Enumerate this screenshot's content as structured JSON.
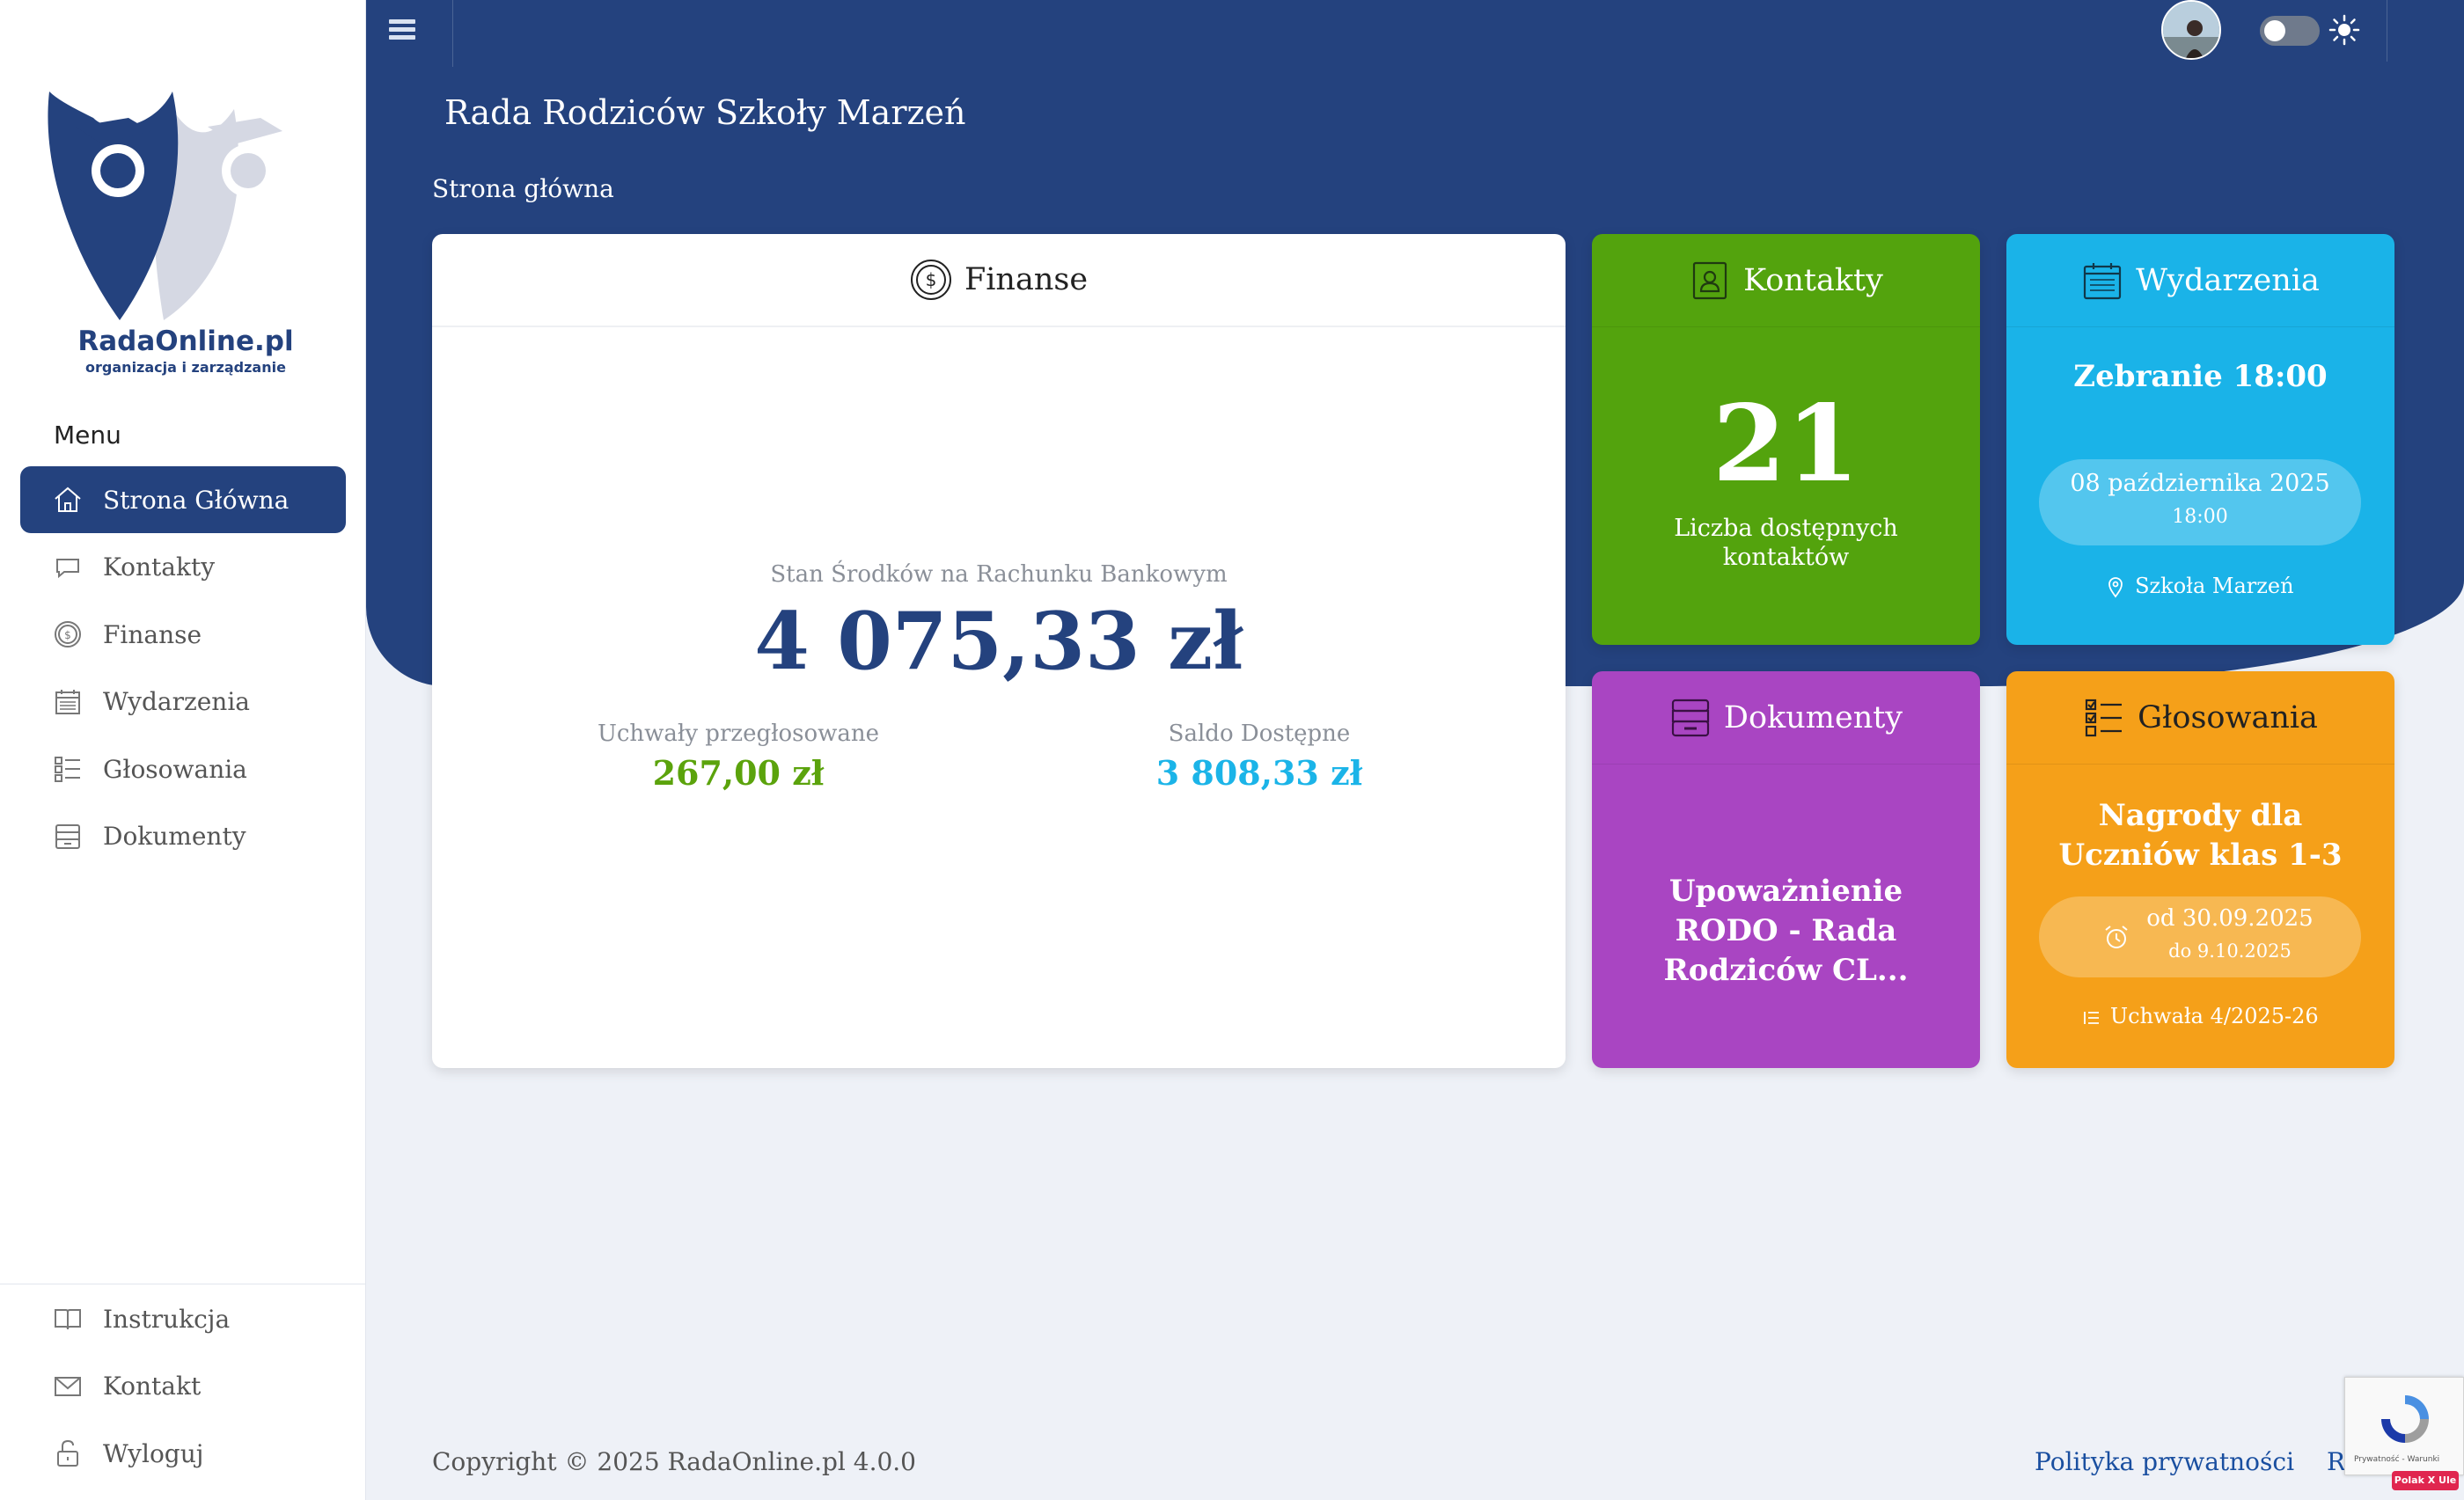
{
  "app": {
    "logo_title": "RadaOnline.pl",
    "logo_subtitle": "organizacja i zarządzanie",
    "page_title": "Rada Rodziców Szkoły Marzeń",
    "breadcrumb": "Strona główna"
  },
  "sidebar": {
    "menu_heading": "Menu",
    "items": [
      {
        "label": "Strona Główna",
        "icon": "home-icon",
        "active": true
      },
      {
        "label": "Kontakty",
        "icon": "chat-icon"
      },
      {
        "label": "Finanse",
        "icon": "coin-icon"
      },
      {
        "label": "Wydarzenia",
        "icon": "calendar-icon"
      },
      {
        "label": "Głosowania",
        "icon": "checklist-icon"
      },
      {
        "label": "Dokumenty",
        "icon": "archive-icon"
      }
    ],
    "bottom_items": [
      {
        "label": "Instrukcja",
        "icon": "book-icon"
      },
      {
        "label": "Kontakt",
        "icon": "envelope-icon"
      },
      {
        "label": "Wyloguj",
        "icon": "unlock-icon"
      }
    ]
  },
  "finance": {
    "title": "Finanse",
    "balance_label": "Stan Środków na Rachunku Bankowym",
    "balance": "4 075,33 zł",
    "approved_label": "Uchwały przegłosowane",
    "approved": "267,00 zł",
    "available_label": "Saldo Dostępne",
    "available": "3 808,33 zł"
  },
  "contacts": {
    "title": "Kontakty",
    "count": "21",
    "label": "Liczba dostępnych kontaktów"
  },
  "events": {
    "title": "Wydarzenia",
    "event_name": "Zebranie 18:00",
    "date": "08 października 2025",
    "time": "18:00",
    "place": "Szkoła Marzeń"
  },
  "documents": {
    "title": "Dokumenty",
    "doc_name": "Upoważnienie RODO - Rada Rodziców CL..."
  },
  "votes": {
    "title": "Głosowania",
    "vote_name": "Nagrody dla Uczniów klas 1-3",
    "from": "od 30.09.2025",
    "to": "do 9.10.2025",
    "resolution": "Uchwała 4/2025-26"
  },
  "footer": {
    "copyright": "Copyright © 2025 RadaOnline.pl 4.0.0",
    "privacy": "Polityka prywatności",
    "terms": "Regul"
  },
  "recaptcha": {
    "text": "Prywatność - Warunki",
    "badge": "Polak X Ule"
  },
  "colors": {
    "primary": "#24427e",
    "green": "#53a30d",
    "cyan": "#1ab3e8",
    "purple": "#a945c2",
    "orange": "#f5a019"
  }
}
